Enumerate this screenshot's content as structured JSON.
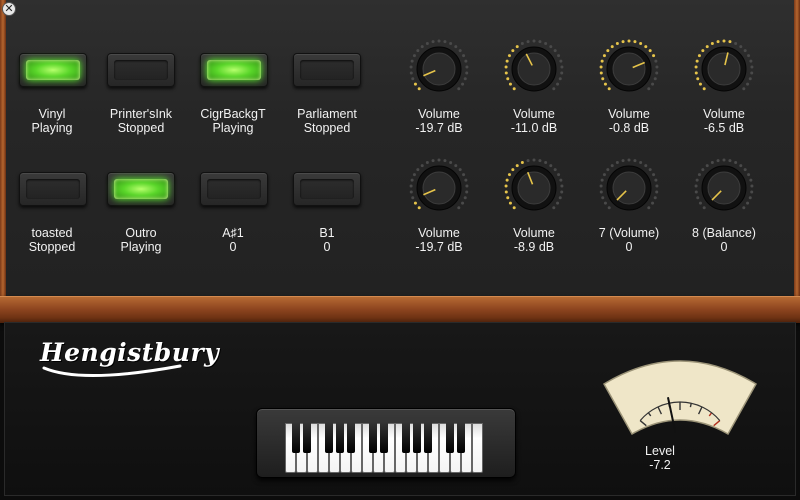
{
  "window": {
    "close_icon": "close-icon"
  },
  "pads": [
    {
      "name": "Vinyl",
      "status": "Playing",
      "on": true
    },
    {
      "name": "Printer'sInk",
      "status": "Stopped",
      "on": false
    },
    {
      "name": "CigrBackgT",
      "status": "Playing",
      "on": true
    },
    {
      "name": "Parliament",
      "status": "Stopped",
      "on": false
    },
    {
      "name": "toasted",
      "status": "Stopped",
      "on": false
    },
    {
      "name": "Outro",
      "status": "Playing",
      "on": true
    },
    {
      "name": "A♯1",
      "status": "0",
      "on": false
    },
    {
      "name": "B1",
      "status": "0",
      "on": false
    }
  ],
  "knobs": [
    {
      "name": "Volume",
      "value": "-19.7 dB",
      "level": 0.08
    },
    {
      "name": "Volume",
      "value": "-11.0 dB",
      "level": 0.4
    },
    {
      "name": "Volume",
      "value": "-0.8 dB",
      "level": 0.75
    },
    {
      "name": "Volume",
      "value": "-6.5 dB",
      "level": 0.55
    },
    {
      "name": "Volume",
      "value": "-19.7 dB",
      "level": 0.08
    },
    {
      "name": "Volume",
      "value": "-8.9 dB",
      "level": 0.42
    },
    {
      "name": "7 (Volume)",
      "value": "0",
      "level": 0.0
    },
    {
      "name": "8 (Balance)",
      "value": "0",
      "level": 0.0
    }
  ],
  "brand": {
    "logo_text": "Hengistbury"
  },
  "meter": {
    "label": "Level",
    "value": "-7.2",
    "level": 0.38
  },
  "colors": {
    "led_on": "#5ad62a",
    "knob_dot": "#e6c44a",
    "meter_face": "#efe6c8",
    "wood": "#8f4620"
  }
}
